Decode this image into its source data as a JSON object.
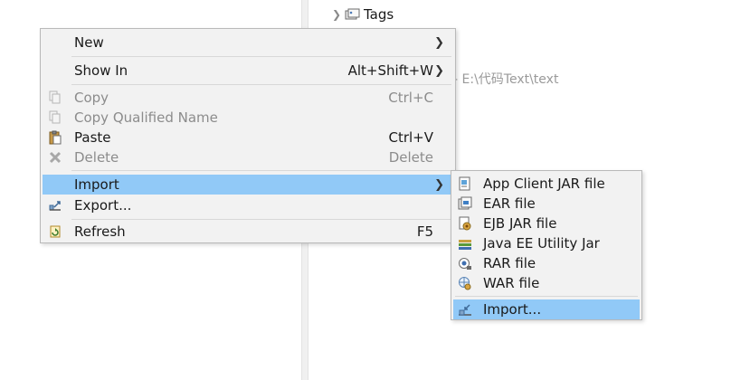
{
  "tree": {
    "tags_label": "Tags"
  },
  "path_text": "- E:\\代码Text\\text",
  "context_menu": {
    "new": {
      "label": "New"
    },
    "show_in": {
      "label": "Show In",
      "shortcut": "Alt+Shift+W"
    },
    "copy": {
      "label": "Copy",
      "shortcut": "Ctrl+C"
    },
    "copy_qualified": {
      "label": "Copy Qualified Name"
    },
    "paste": {
      "label": "Paste",
      "shortcut": "Ctrl+V"
    },
    "delete": {
      "label": "Delete",
      "shortcut": "Delete"
    },
    "import": {
      "label": "Import"
    },
    "export": {
      "label": "Export..."
    },
    "refresh": {
      "label": "Refresh",
      "shortcut": "F5"
    }
  },
  "import_submenu": {
    "items": [
      {
        "label": "App Client JAR file",
        "icon": "app-client-jar-icon"
      },
      {
        "label": "EAR file",
        "icon": "ear-file-icon"
      },
      {
        "label": "EJB JAR file",
        "icon": "ejb-jar-icon"
      },
      {
        "label": "Java EE Utility Jar",
        "icon": "utility-jar-icon"
      },
      {
        "label": "RAR file",
        "icon": "rar-file-icon"
      },
      {
        "label": "WAR file",
        "icon": "war-file-icon"
      },
      {
        "label": "Import...",
        "icon": "import-wizard-icon"
      }
    ]
  },
  "colors": {
    "highlight": "#91c9f7",
    "menu_bg": "#f2f2f2",
    "disabled_text": "#8c8c8c"
  }
}
